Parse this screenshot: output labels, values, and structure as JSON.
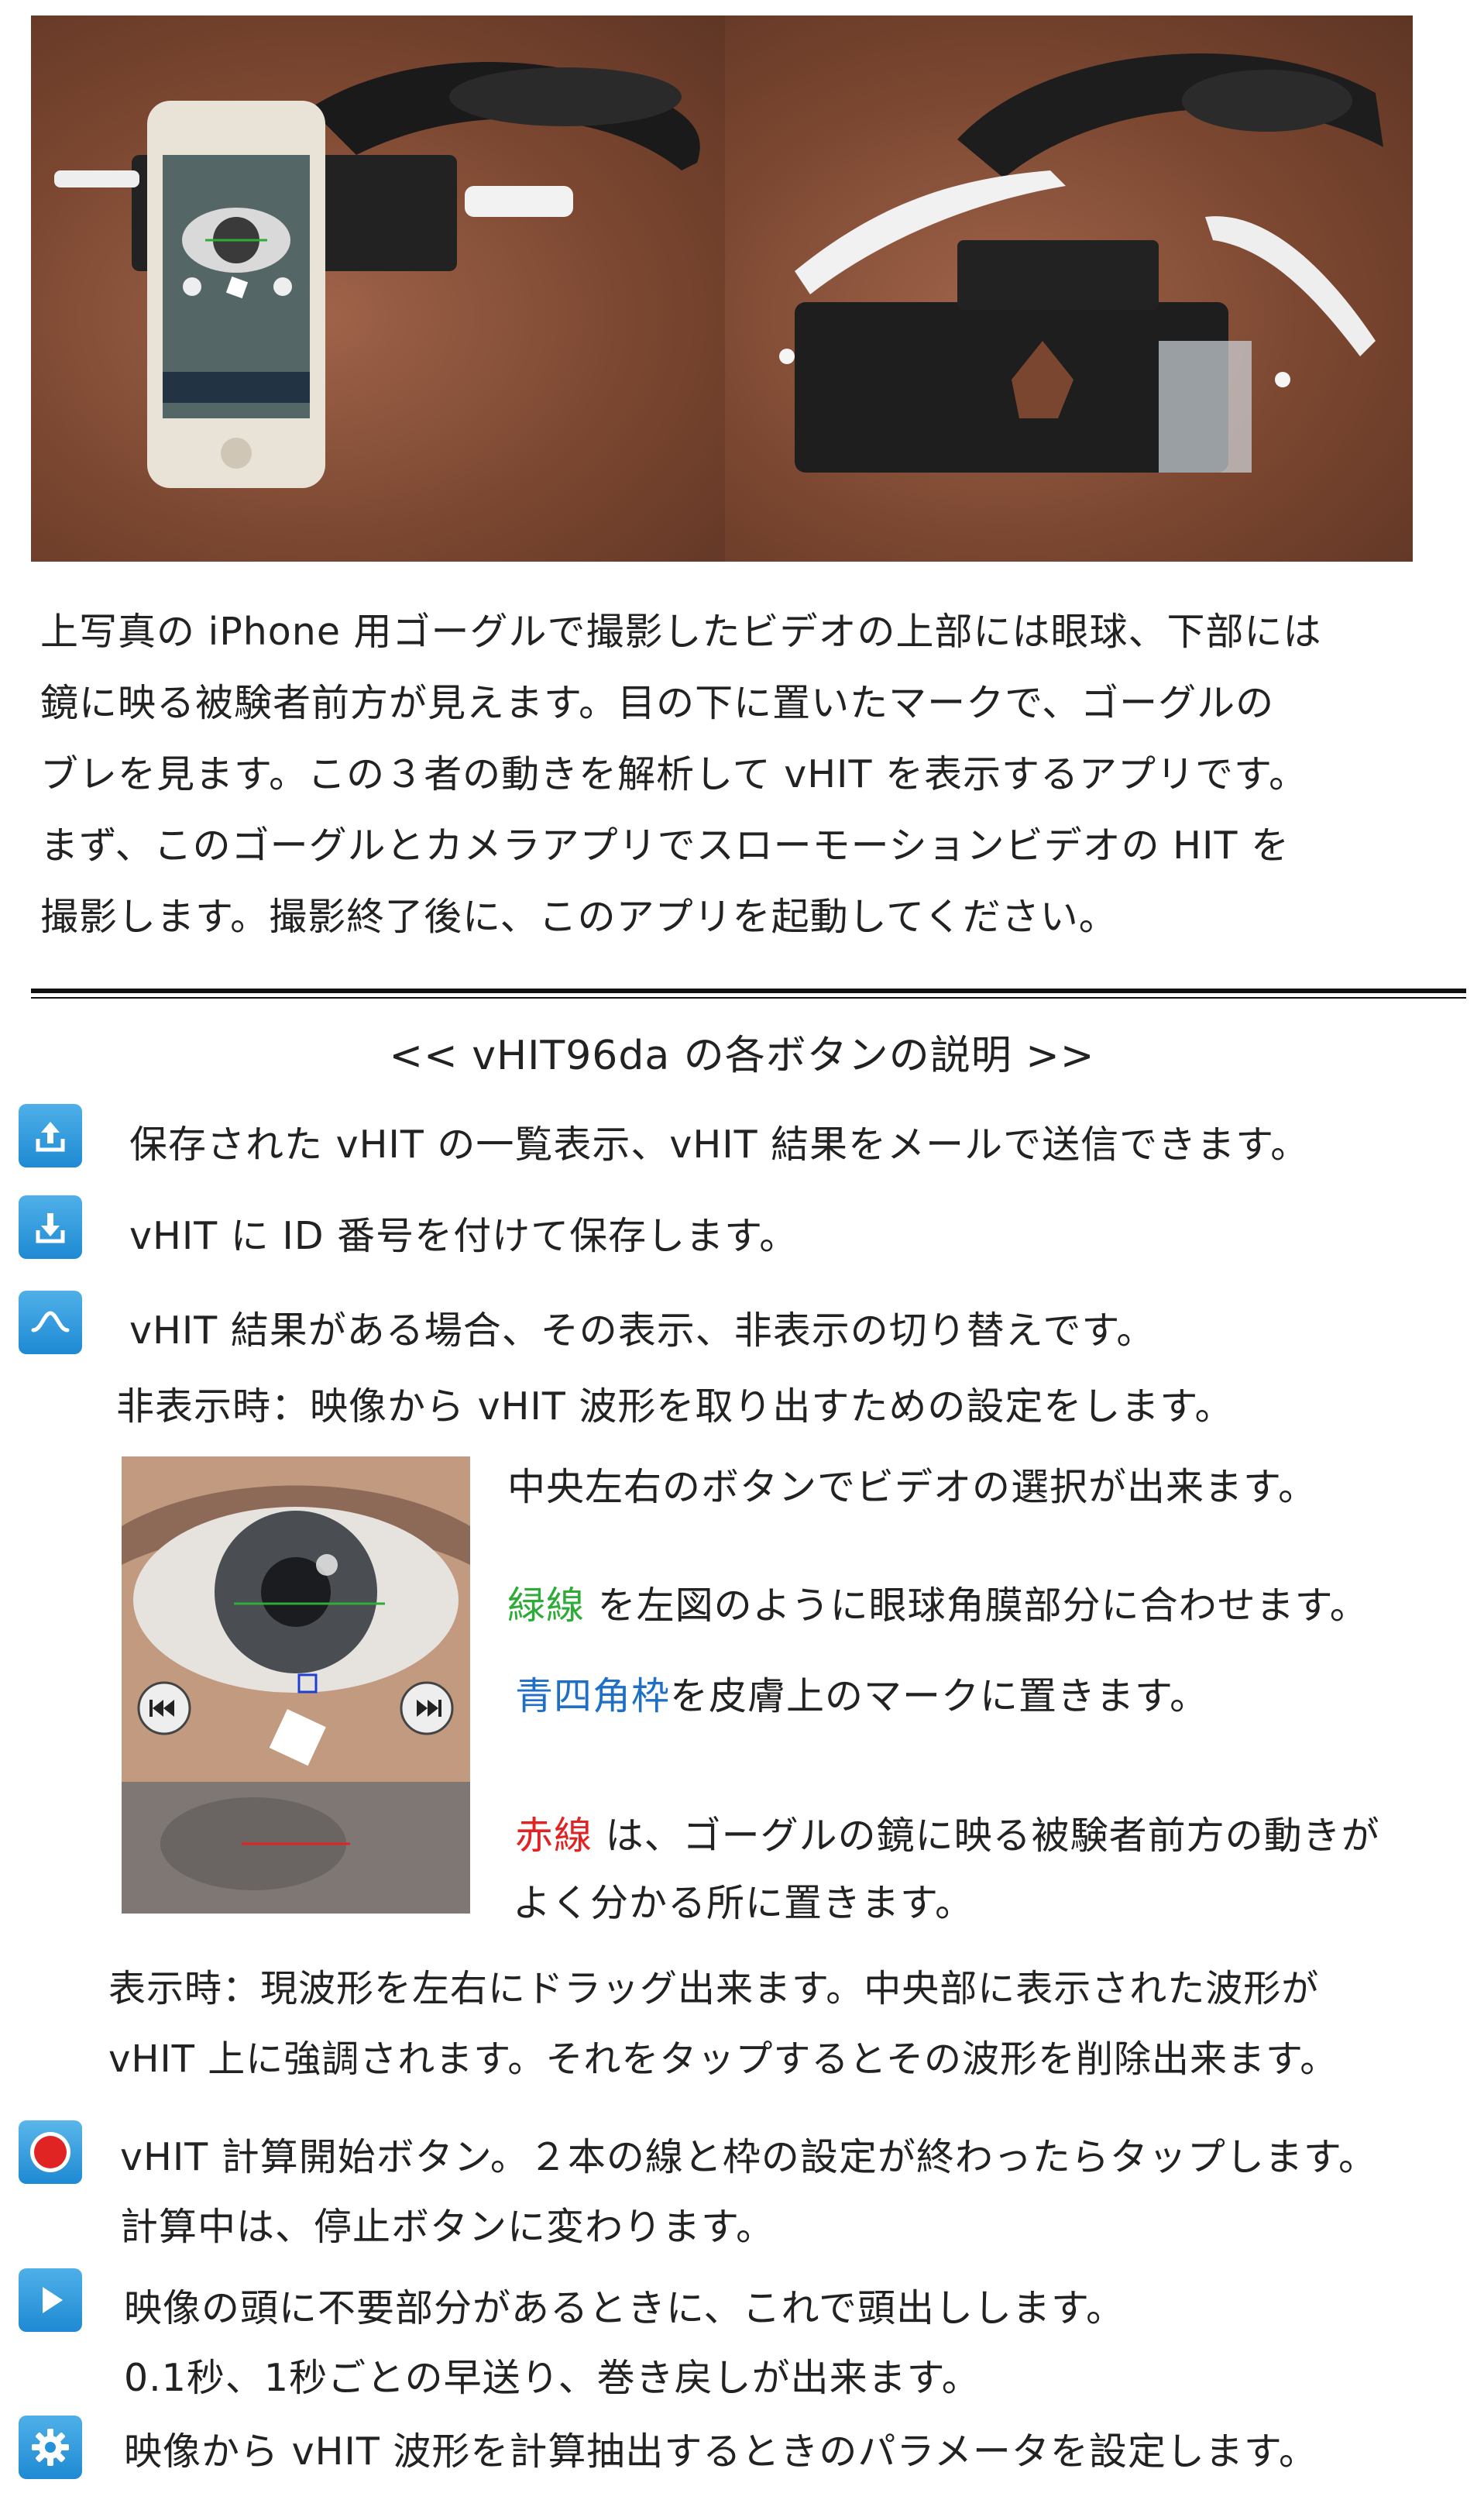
{
  "intro": {
    "lines": [
      "上写真の iPhone 用ゴーグルで撮影したビデオの上部には眼球、下部には",
      "鏡に映る被験者前方が見えます。目の下に置いたマークで、ゴーグルの",
      "ブレを見ます。この３者の動きを解析して vHIT を表示するアプリです。",
      "まず、このゴーグルとカメラアプリでスローモーションビデオの HIT を",
      "撮影します。撮影終了後に、このアプリを起動してください。"
    ]
  },
  "heading": "<<  vHIT96da の各ボタンの説明  >>",
  "buttons": {
    "upload": "保存された vHIT の一覧表示、vHIT 結果をメールで送信できます。",
    "download": "vHIT に ID 番号を付けて保存します。",
    "wave": "vHIT 結果がある場合、その表示、非表示の切り替えです。",
    "wave_hidden": "非表示時：映像から vHIT 波形を取り出すための設定をします。"
  },
  "eye_notes": {
    "select": "中央左右のボタンでビデオの選択が出来ます。",
    "green_label": "緑線",
    "green_text": " を左図のように眼球角膜部分に合わせます。",
    "blue_label": "青四角枠",
    "blue_text": "を皮膚上のマークに置きます。",
    "red_label": "赤線",
    "red_text_1": " は、ゴーグルの鏡に映る被験者前方の動きが",
    "red_text_2": "よく分かる所に置きます。"
  },
  "display_mode": {
    "line1": "表示時：現波形を左右にドラッグ出来ます。中央部に表示された波形が",
    "line2": "vHIT 上に強調されます。それをタップするとその波形を削除出来ます。"
  },
  "record": {
    "line1": "vHIT 計算開始ボタン。２本の線と枠の設定が終わったらタップします。",
    "line2": "計算中は、停止ボタンに変わります。"
  },
  "play": {
    "line1": "映像の頭に不要部分があるときに、これで頭出しします。",
    "line2": "0.1秒、1秒ごとの早送り、巻き戻しが出来ます。"
  },
  "settings": {
    "line1": "映像から vHIT 波形を計算抽出するときのパラメータを設定します。"
  },
  "colors": {
    "accent": "#2392d8",
    "record": "#e02424",
    "green_line": "#2eab38",
    "blue_box": "#1f6fc6",
    "red_line": "#e02424"
  }
}
